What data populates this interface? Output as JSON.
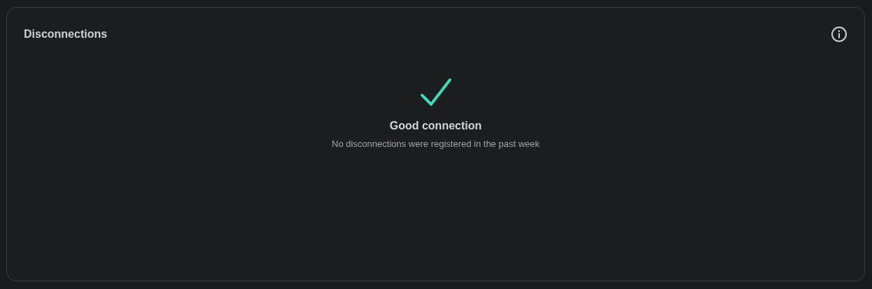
{
  "card": {
    "title": "Disconnections",
    "status": {
      "kind": "good",
      "heading": "Good connection",
      "message": "No disconnections were registered in the past week"
    }
  }
}
